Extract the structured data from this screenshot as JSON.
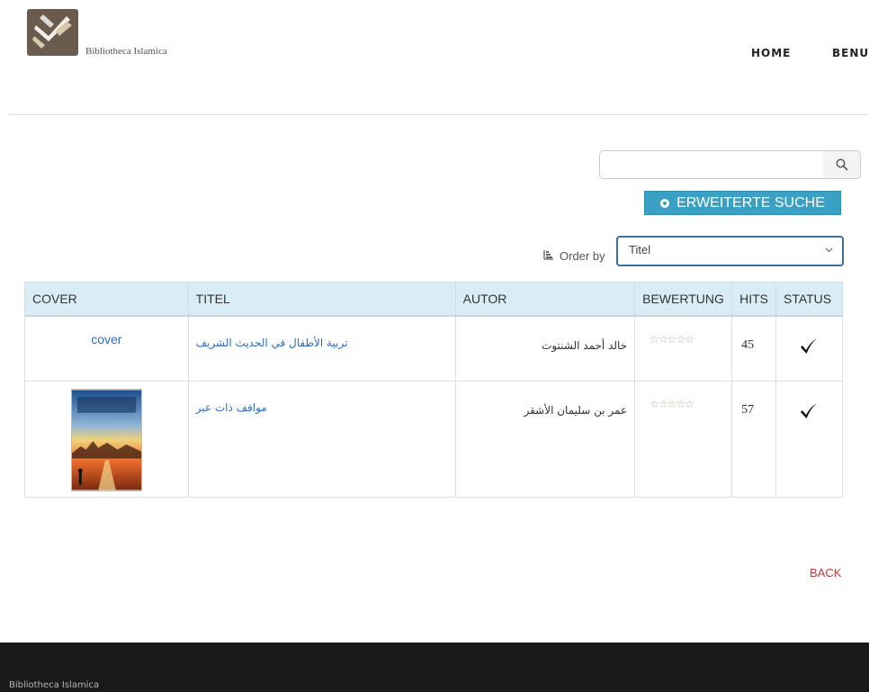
{
  "header": {
    "brand": "Bibliotheca Islamica",
    "nav": [
      {
        "label": "HOME"
      },
      {
        "label": "BENU"
      }
    ]
  },
  "search": {
    "value": "",
    "placeholder": "",
    "advanced_label": "ERWEITERTE SUCHE"
  },
  "order": {
    "label": "Order by",
    "selected": "Titel"
  },
  "table": {
    "headers": [
      "COVER",
      "TITEL",
      "AUTOR",
      "BEWERTUNG",
      "HITS",
      "STATUS"
    ],
    "rows": [
      {
        "cover": "cover",
        "titel": "تربية الأطفال في الحديث الشريف",
        "autor": "خالد أحمد الشنتوت",
        "bewertung": "☆☆☆☆☆",
        "hits": "45",
        "status": "✓"
      },
      {
        "cover": "",
        "titel": "مواقف ذات عبر",
        "autor": "عمر بن سليمان الأشقر",
        "bewertung": "☆☆☆☆☆",
        "hits": "57",
        "status": "✓"
      }
    ]
  },
  "back_label": "BACK",
  "footer": {
    "text": "Bibliotheca Islamica"
  },
  "colors": {
    "accent": "#3aa0c4",
    "header_bg": "#d9edf7",
    "link": "#2a6cc2",
    "back": "#b83b3b",
    "footer_bg": "#1a1a1a",
    "logo": "#6b5a4e"
  },
  "icons": {
    "search": "search-icon",
    "gear": "gear-icon",
    "order": "sort-icon",
    "chevron": "chevron-down-icon",
    "check": "check-icon"
  }
}
